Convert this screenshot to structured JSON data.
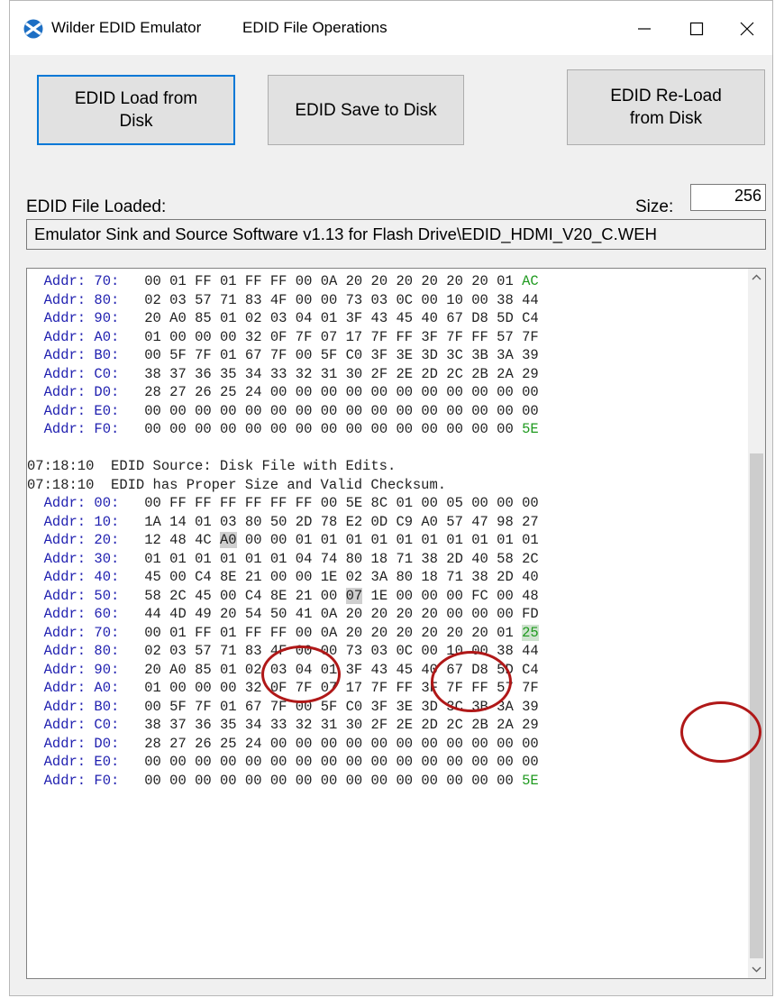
{
  "window": {
    "app_title": "Wilder EDID Emulator",
    "menu": "EDID File Operations",
    "controls": {
      "minimize": "minimize-icon",
      "maximize": "maximize-icon",
      "close": "close-icon"
    },
    "icon": "wilder-logo-icon"
  },
  "buttons": {
    "load": {
      "line1": "EDID Load from",
      "line2": "Disk"
    },
    "save": "EDID Save to Disk",
    "reload": {
      "line1": "EDID Re-Load",
      "line2": "from Disk"
    }
  },
  "file": {
    "loaded_label": "EDID File Loaded:",
    "size_label": "Size:",
    "size_value": "256",
    "path": "Emulator Sink and Source Software v1.13 for Flash Drive\\EDID_HDMI_V20_C.WEH"
  },
  "log": {
    "block1": [
      {
        "addr": "Addr: 70:",
        "bytes": [
          "00",
          "01",
          "FF",
          "01",
          "FF",
          "FF",
          "00",
          "0A",
          "20",
          "20",
          "20",
          "20",
          "20",
          "20",
          "01",
          "AC"
        ]
      },
      {
        "addr": "Addr: 80:",
        "bytes": [
          "02",
          "03",
          "57",
          "71",
          "83",
          "4F",
          "00",
          "00",
          "73",
          "03",
          "0C",
          "00",
          "10",
          "00",
          "38",
          "44"
        ]
      },
      {
        "addr": "Addr: 90:",
        "bytes": [
          "20",
          "A0",
          "85",
          "01",
          "02",
          "03",
          "04",
          "01",
          "3F",
          "43",
          "45",
          "40",
          "67",
          "D8",
          "5D",
          "C4"
        ]
      },
      {
        "addr": "Addr: A0:",
        "bytes": [
          "01",
          "00",
          "00",
          "00",
          "32",
          "0F",
          "7F",
          "07",
          "17",
          "7F",
          "FF",
          "3F",
          "7F",
          "FF",
          "57",
          "7F"
        ]
      },
      {
        "addr": "Addr: B0:",
        "bytes": [
          "00",
          "5F",
          "7F",
          "01",
          "67",
          "7F",
          "00",
          "5F",
          "C0",
          "3F",
          "3E",
          "3D",
          "3C",
          "3B",
          "3A",
          "39"
        ]
      },
      {
        "addr": "Addr: C0:",
        "bytes": [
          "38",
          "37",
          "36",
          "35",
          "34",
          "33",
          "32",
          "31",
          "30",
          "2F",
          "2E",
          "2D",
          "2C",
          "2B",
          "2A",
          "29"
        ]
      },
      {
        "addr": "Addr: D0:",
        "bytes": [
          "28",
          "27",
          "26",
          "25",
          "24",
          "00",
          "00",
          "00",
          "00",
          "00",
          "00",
          "00",
          "00",
          "00",
          "00",
          "00"
        ]
      },
      {
        "addr": "Addr: E0:",
        "bytes": [
          "00",
          "00",
          "00",
          "00",
          "00",
          "00",
          "00",
          "00",
          "00",
          "00",
          "00",
          "00",
          "00",
          "00",
          "00",
          "00"
        ]
      },
      {
        "addr": "Addr: F0:",
        "bytes": [
          "00",
          "00",
          "00",
          "00",
          "00",
          "00",
          "00",
          "00",
          "00",
          "00",
          "00",
          "00",
          "00",
          "00",
          "00",
          "5E"
        ]
      }
    ],
    "messages": [
      "07:18:10  EDID Source: Disk File with Edits.",
      "07:18:10  EDID has Proper Size and Valid Checksum."
    ],
    "block2": [
      {
        "addr": "Addr: 00:",
        "bytes": [
          "00",
          "FF",
          "FF",
          "FF",
          "FF",
          "FF",
          "FF",
          "00",
          "5E",
          "8C",
          "01",
          "00",
          "05",
          "00",
          "00",
          "00"
        ]
      },
      {
        "addr": "Addr: 10:",
        "bytes": [
          "1A",
          "14",
          "01",
          "03",
          "80",
          "50",
          "2D",
          "78",
          "E2",
          "0D",
          "C9",
          "A0",
          "57",
          "47",
          "98",
          "27"
        ]
      },
      {
        "addr": "Addr: 20:",
        "bytes": [
          "12",
          "48",
          "4C",
          "A0",
          "00",
          "00",
          "01",
          "01",
          "01",
          "01",
          "01",
          "01",
          "01",
          "01",
          "01",
          "01"
        ]
      },
      {
        "addr": "Addr: 30:",
        "bytes": [
          "01",
          "01",
          "01",
          "01",
          "01",
          "01",
          "04",
          "74",
          "80",
          "18",
          "71",
          "38",
          "2D",
          "40",
          "58",
          "2C"
        ]
      },
      {
        "addr": "Addr: 40:",
        "bytes": [
          "45",
          "00",
          "C4",
          "8E",
          "21",
          "00",
          "00",
          "1E",
          "02",
          "3A",
          "80",
          "18",
          "71",
          "38",
          "2D",
          "40"
        ]
      },
      {
        "addr": "Addr: 50:",
        "bytes": [
          "58",
          "2C",
          "45",
          "00",
          "C4",
          "8E",
          "21",
          "00",
          "07",
          "1E",
          "00",
          "00",
          "00",
          "FC",
          "00",
          "48"
        ]
      },
      {
        "addr": "Addr: 60:",
        "bytes": [
          "44",
          "4D",
          "49",
          "20",
          "54",
          "50",
          "41",
          "0A",
          "20",
          "20",
          "20",
          "20",
          "00",
          "00",
          "00",
          "FD"
        ]
      },
      {
        "addr": "Addr: 70:",
        "bytes": [
          "00",
          "01",
          "FF",
          "01",
          "FF",
          "FF",
          "00",
          "0A",
          "20",
          "20",
          "20",
          "20",
          "20",
          "20",
          "01",
          "25"
        ]
      },
      {
        "addr": "Addr: 80:",
        "bytes": [
          "02",
          "03",
          "57",
          "71",
          "83",
          "4F",
          "00",
          "00",
          "73",
          "03",
          "0C",
          "00",
          "10",
          "00",
          "38",
          "44"
        ]
      },
      {
        "addr": "Addr: 90:",
        "bytes": [
          "20",
          "A0",
          "85",
          "01",
          "02",
          "03",
          "04",
          "01",
          "3F",
          "43",
          "45",
          "40",
          "67",
          "D8",
          "5D",
          "C4"
        ]
      },
      {
        "addr": "Addr: A0:",
        "bytes": [
          "01",
          "00",
          "00",
          "00",
          "32",
          "0F",
          "7F",
          "07",
          "17",
          "7F",
          "FF",
          "3F",
          "7F",
          "FF",
          "57",
          "7F"
        ]
      },
      {
        "addr": "Addr: B0:",
        "bytes": [
          "00",
          "5F",
          "7F",
          "01",
          "67",
          "7F",
          "00",
          "5F",
          "C0",
          "3F",
          "3E",
          "3D",
          "3C",
          "3B",
          "3A",
          "39"
        ]
      },
      {
        "addr": "Addr: C0:",
        "bytes": [
          "38",
          "37",
          "36",
          "35",
          "34",
          "33",
          "32",
          "31",
          "30",
          "2F",
          "2E",
          "2D",
          "2C",
          "2B",
          "2A",
          "29"
        ]
      },
      {
        "addr": "Addr: D0:",
        "bytes": [
          "28",
          "27",
          "26",
          "25",
          "24",
          "00",
          "00",
          "00",
          "00",
          "00",
          "00",
          "00",
          "00",
          "00",
          "00",
          "00"
        ]
      },
      {
        "addr": "Addr: E0:",
        "bytes": [
          "00",
          "00",
          "00",
          "00",
          "00",
          "00",
          "00",
          "00",
          "00",
          "00",
          "00",
          "00",
          "00",
          "00",
          "00",
          "00"
        ]
      },
      {
        "addr": "Addr: F0:",
        "bytes": [
          "00",
          "00",
          "00",
          "00",
          "00",
          "00",
          "00",
          "00",
          "00",
          "00",
          "00",
          "00",
          "00",
          "00",
          "00",
          "5E"
        ]
      }
    ],
    "highlights": [
      "20:A0",
      "50:07",
      "70:25"
    ],
    "annotation_color": "#b01818"
  },
  "colors": {
    "address": "#2020b0",
    "checksum": "#1f9a1f",
    "accent": "#0078d7"
  }
}
